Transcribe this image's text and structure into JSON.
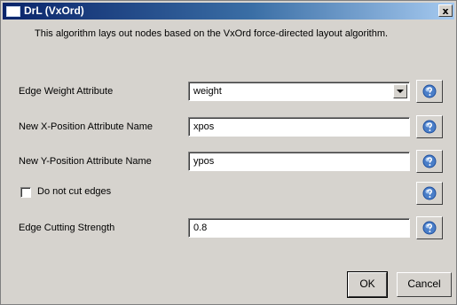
{
  "window": {
    "title": "DrL (VxOrd)",
    "close_label": "x"
  },
  "description": "This algorithm lays out nodes based on the VxOrd force-directed layout algorithm.",
  "fields": {
    "edge_weight": {
      "label": "Edge Weight Attribute",
      "value": "weight"
    },
    "new_x": {
      "label": "New X-Position Attribute Name",
      "value": "xpos"
    },
    "new_y": {
      "label": "New Y-Position Attribute Name",
      "value": "ypos"
    },
    "no_cut": {
      "label": "Do not cut edges",
      "checked": false
    },
    "cutting_strength": {
      "label": "Edge Cutting Strength",
      "value": "0.8"
    }
  },
  "buttons": {
    "ok": "OK",
    "cancel": "Cancel"
  },
  "icons": {
    "help": "help-icon",
    "dropdown": "chevron-down-icon",
    "window": "window-icon"
  }
}
